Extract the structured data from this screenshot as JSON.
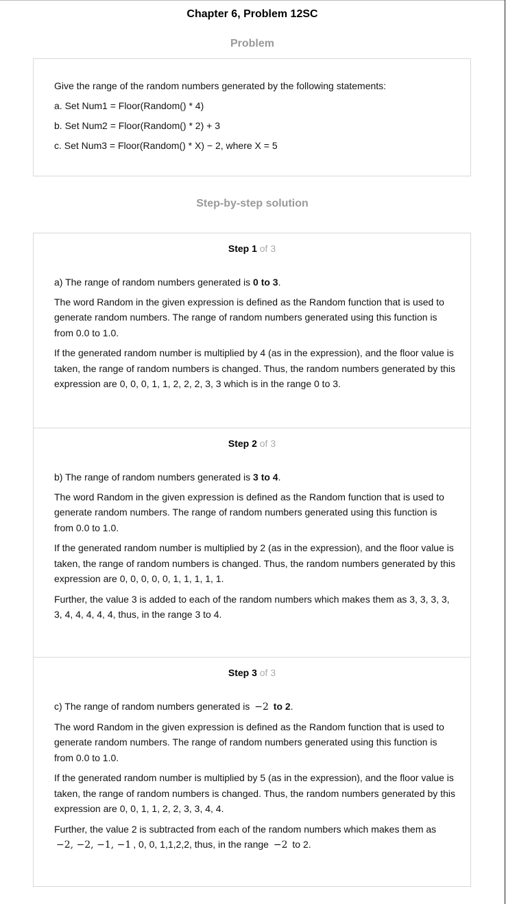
{
  "title": "Chapter 6, Problem 12SC",
  "problem": {
    "heading": "Problem",
    "intro": "Give the range of the random numbers generated by the following statements:",
    "items": [
      "a. Set Num1 = Floor(Random() * 4)",
      "b. Set Num2 = Floor(Random() * 2) + 3",
      "c. Set Num3 = Floor(Random() * X) − 2, where X = 5"
    ]
  },
  "solution": {
    "heading": "Step-by-step solution",
    "steps": [
      {
        "step_word": "Step 1",
        "of_text": "of 3",
        "answer_prefix": "a) The range of random numbers generated is ",
        "answer_bold": "0 to 3",
        "answer_suffix": ".",
        "paragraphs": [
          "The word Random in the given expression is defined as the Random function that is used to generate random numbers. The range of random numbers generated using this function is from 0.0 to 1.0.",
          "If the generated random number is multiplied by 4 (as in the expression), and the floor value is taken, the range of random numbers is changed. Thus, the random numbers generated by this expression are 0, 0, 0, 1, 1, 2, 2, 2, 3, 3 which is in the range 0 to 3."
        ]
      },
      {
        "step_word": "Step 2",
        "of_text": "of 3",
        "answer_prefix": "b) The range of random numbers generated is ",
        "answer_bold": "3 to 4",
        "answer_suffix": ".",
        "paragraphs": [
          "The word Random in the given expression is defined as the Random function that is used to generate random numbers. The range of random numbers generated using this function is from 0.0 to 1.0.",
          "If the generated random number is multiplied by 2 (as in the expression), and the floor value is taken, the range of random numbers is changed. Thus, the random numbers generated by this expression are 0, 0, 0, 0, 0, 1, 1, 1, 1, 1.",
          "Further, the value 3 is added to each of the random numbers which makes them as 3, 3, 3, 3, 3, 4, 4, 4, 4, 4, thus, in the range 3 to 4."
        ]
      },
      {
        "step_word": "Step 3",
        "of_text": "of 3",
        "answer_prefix": "c) The range of random numbers generated is ",
        "answer_math": "−2",
        "answer_bold": " to 2",
        "answer_suffix": ".",
        "paragraphs": [
          "The word Random in the given expression is defined as the Random function that is used to generate random numbers. The range of random numbers generated using this function is from 0.0 to 1.0.",
          "If the generated random number is multiplied by 5 (as in the expression), and the floor value is taken, the range of random numbers is changed. Thus, the random numbers generated by this expression are 0, 0, 1, 1, 2, 2, 3, 3, 4, 4."
        ],
        "final_para": {
          "text_before": "Further, the value 2 is subtracted from each of the random numbers which makes them as ",
          "math_values": "−2, −2, −1, −1",
          "text_middle": ", 0, 0, 1,1,2,2, thus, in the range ",
          "math_range": "−2",
          "text_after": " to 2."
        }
      }
    ]
  }
}
